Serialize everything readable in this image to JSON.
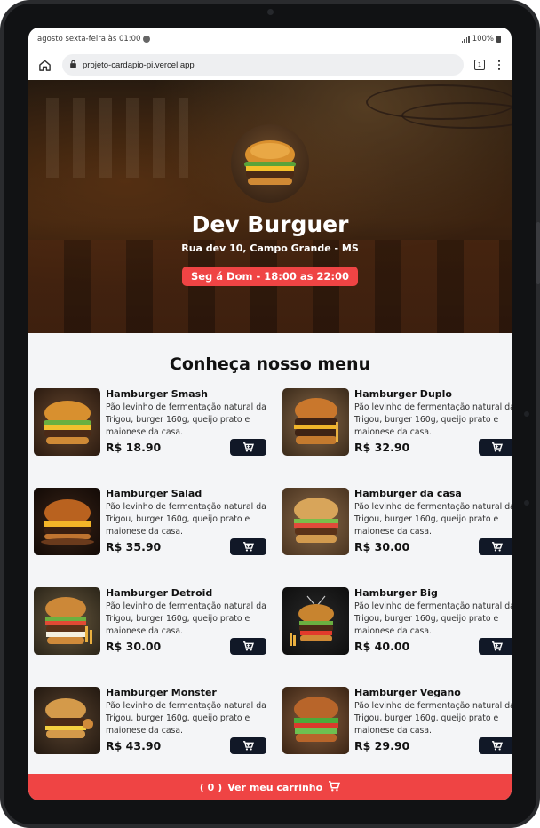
{
  "status_bar": {
    "time_text": "agosto sexta-feira às 01:00",
    "battery_text": "100%"
  },
  "browser": {
    "url": "projeto-cardapio-pi.vercel.app",
    "tab_count": "1"
  },
  "hero": {
    "title": "Dev Burguer",
    "address": "Rua dev 10, Campo Grande - MS",
    "hours": "Seg á Dom - 18:00 as 22:00"
  },
  "menu": {
    "heading": "Conheça nosso menu",
    "items": [
      {
        "name": "Hamburger Smash",
        "desc": "Pão levinho de fermentação natural da Trigou, burger 160g, queijo prato e maionese da casa.",
        "price": "R$ 18.90"
      },
      {
        "name": "Hamburger Duplo",
        "desc": "Pão levinho de fermentação natural da Trigou, burger 160g, queijo prato e maionese da casa.",
        "price": "R$ 32.90"
      },
      {
        "name": "Hamburger Salad",
        "desc": "Pão levinho de fermentação natural da Trigou, burger 160g, queijo prato e maionese da casa.",
        "price": "R$ 35.90"
      },
      {
        "name": "Hamburger da casa",
        "desc": "Pão levinho de fermentação natural da Trigou, burger 160g, queijo prato e maionese da casa.",
        "price": "R$ 30.00"
      },
      {
        "name": "Hamburger Detroid",
        "desc": "Pão levinho de fermentação natural da Trigou, burger 160g, queijo prato e maionese da casa.",
        "price": "R$ 30.00"
      },
      {
        "name": "Hamburger Big",
        "desc": "Pão levinho de fermentação natural da Trigou, burger 160g, queijo prato e maionese da casa.",
        "price": "R$ 40.00"
      },
      {
        "name": "Hamburger Monster",
        "desc": "Pão levinho de fermentação natural da Trigou, burger 160g, queijo prato e maionese da casa.",
        "price": "R$ 43.90"
      },
      {
        "name": "Hamburger Vegano",
        "desc": "Pão levinho de fermentação natural da Trigou, burger 160g, queijo prato e maionese da casa.",
        "price": "R$ 29.90"
      }
    ]
  },
  "cart": {
    "count_text": "( 0 )",
    "label": "Ver meu carrinho"
  },
  "colors": {
    "accent": "#ef4444",
    "button_dark": "#111827",
    "menu_bg": "#f4f5f7"
  },
  "icons": {
    "home": "home-icon",
    "lock": "lock-icon",
    "tabs": "tabs-icon",
    "menu": "kebab-menu-icon",
    "cart": "cart-icon"
  }
}
